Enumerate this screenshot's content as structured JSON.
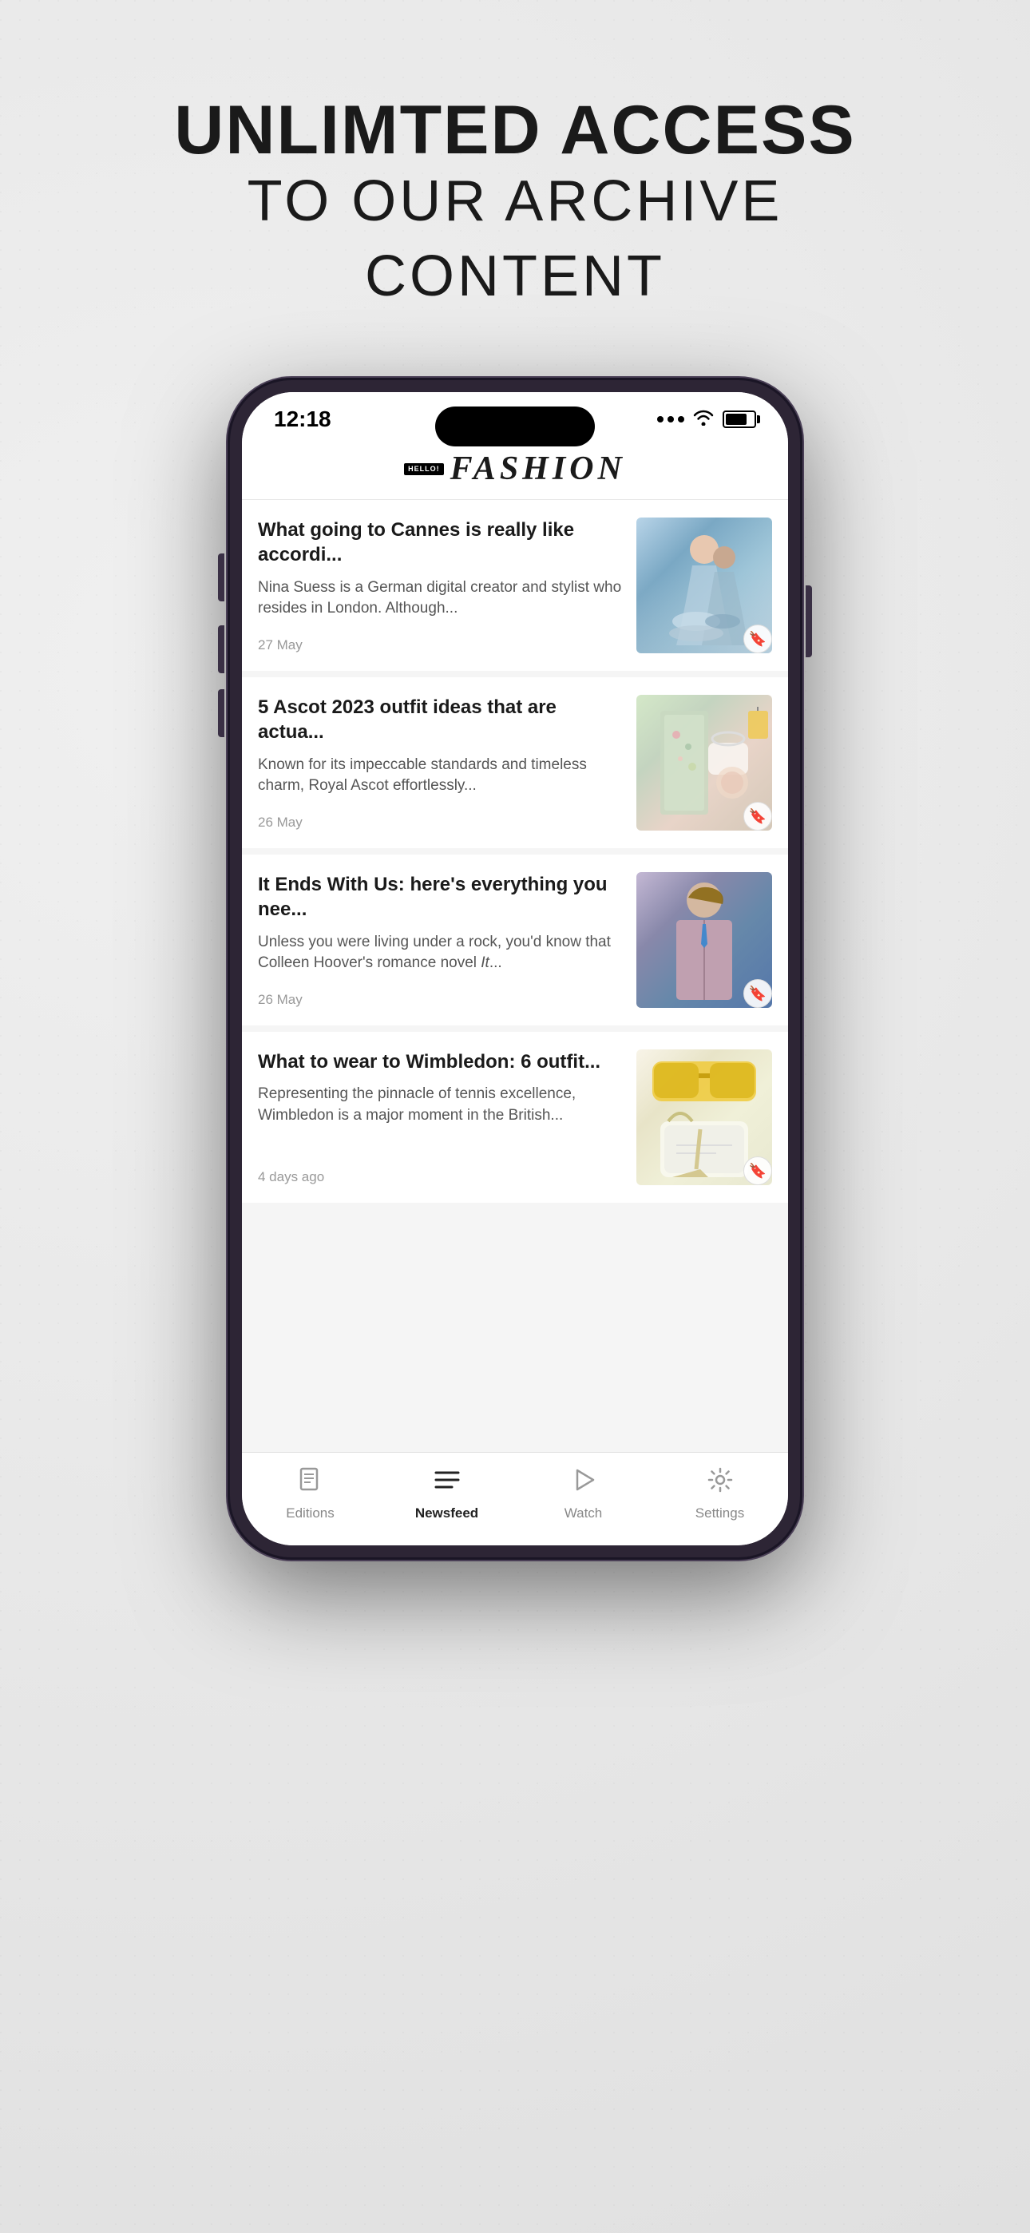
{
  "page": {
    "background_color": "#e8e8e8"
  },
  "headline": {
    "line1": "UNLIMTED ACCESS",
    "line2": "TO OUR ARCHIVE",
    "line3": "CONTENT"
  },
  "status_bar": {
    "time": "12:18",
    "signal": "...",
    "wifi": "wifi",
    "battery": "battery"
  },
  "app": {
    "logo_hello": "HELLO!",
    "logo_fashion": "FASHION"
  },
  "articles": [
    {
      "title": "What going to Cannes is really like accordi...",
      "excerpt": "Nina Suess is a German digital creator and stylist who resides in London. Although...",
      "date": "27 May",
      "image_type": "cannes",
      "bookmark": "bookmark"
    },
    {
      "title": "5 Ascot 2023 outfit ideas that are actua...",
      "excerpt": "Known for its impeccable standards and timeless charm, Royal Ascot effortlessly...",
      "date": "26 May",
      "image_type": "ascot",
      "bookmark": "bookmark"
    },
    {
      "title": "It Ends With Us: here's everything you nee...",
      "excerpt": "Unless you were living under a rock, you'd know that Colleen Hoover's romance novel It...",
      "date": "26 May",
      "image_type": "movie",
      "bookmark": "bookmark"
    },
    {
      "title": "What to wear to Wimbledon: 6 outfit...",
      "excerpt": "Representing the pinnacle of tennis excellence, Wimbledon is a major moment in the British...",
      "date": "4 days ago",
      "image_type": "wimbledon",
      "bookmark": "bookmark"
    }
  ],
  "nav": {
    "items": [
      {
        "id": "editions",
        "label": "Editions",
        "icon": "book",
        "active": false
      },
      {
        "id": "newsfeed",
        "label": "Newsfeed",
        "icon": "menu",
        "active": true
      },
      {
        "id": "watch",
        "label": "Watch",
        "icon": "play",
        "active": false
      },
      {
        "id": "settings",
        "label": "Settings",
        "icon": "gear",
        "active": false
      }
    ]
  }
}
